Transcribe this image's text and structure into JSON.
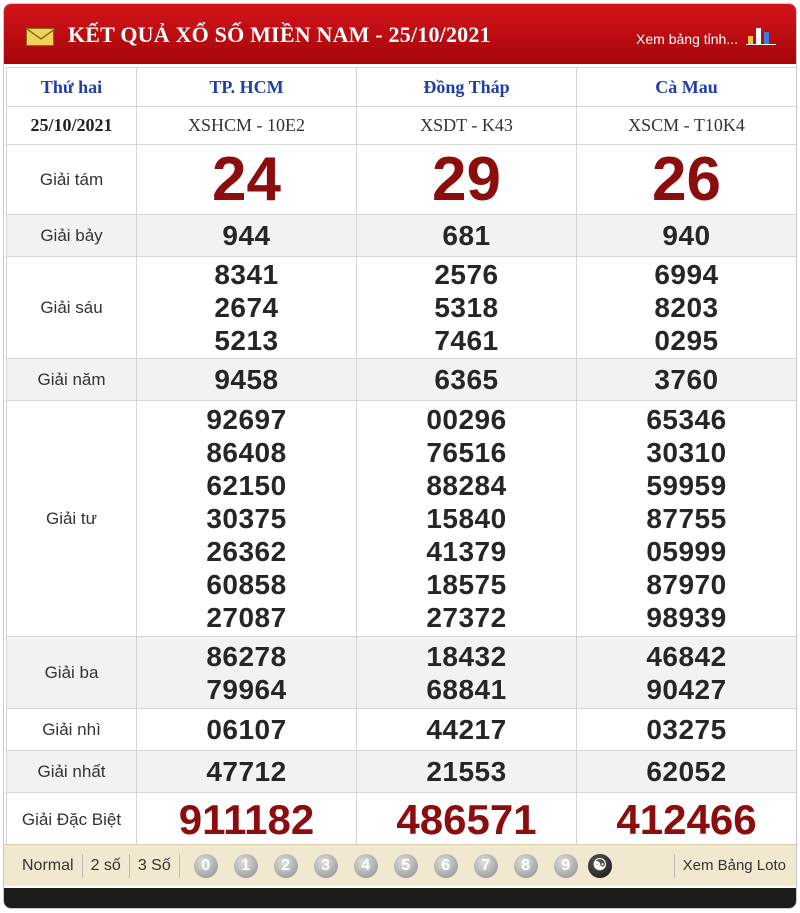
{
  "header": {
    "title": "KẾT QUẢ XỔ SỐ MIỀN NAM - 25/10/2021",
    "view_link": "Xem bảng tỉnh..."
  },
  "columns": {
    "day": "Thứ hai",
    "date": "25/10/2021",
    "provinces": [
      {
        "name": "TP. HCM",
        "code": "XSHCM - 10E2"
      },
      {
        "name": "Đồng Tháp",
        "code": "XSDT - K43"
      },
      {
        "name": "Cà Mau",
        "code": "XSCM - T10K4"
      }
    ]
  },
  "prizes": [
    {
      "name": "Giải tám",
      "style": "big",
      "values": [
        [
          "24"
        ],
        [
          "29"
        ],
        [
          "26"
        ]
      ]
    },
    {
      "name": "Giải bảy",
      "style": "num",
      "values": [
        [
          "944"
        ],
        [
          "681"
        ],
        [
          "940"
        ]
      ]
    },
    {
      "name": "Giải sáu",
      "style": "num",
      "values": [
        [
          "8341",
          "2674",
          "5213"
        ],
        [
          "2576",
          "5318",
          "7461"
        ],
        [
          "6994",
          "8203",
          "0295"
        ]
      ]
    },
    {
      "name": "Giải năm",
      "style": "num",
      "values": [
        [
          "9458"
        ],
        [
          "6365"
        ],
        [
          "3760"
        ]
      ]
    },
    {
      "name": "Giải tư",
      "style": "num",
      "values": [
        [
          "92697",
          "86408",
          "62150",
          "30375",
          "26362",
          "60858",
          "27087"
        ],
        [
          "00296",
          "76516",
          "88284",
          "15840",
          "41379",
          "18575",
          "27372"
        ],
        [
          "65346",
          "30310",
          "59959",
          "87755",
          "05999",
          "87970",
          "98939"
        ]
      ]
    },
    {
      "name": "Giải ba",
      "style": "num",
      "values": [
        [
          "86278",
          "79964"
        ],
        [
          "18432",
          "68841"
        ],
        [
          "46842",
          "90427"
        ]
      ]
    },
    {
      "name": "Giải nhì",
      "style": "num",
      "values": [
        [
          "06107"
        ],
        [
          "44217"
        ],
        [
          "03275"
        ]
      ]
    },
    {
      "name": "Giải nhất",
      "style": "num",
      "values": [
        [
          "47712"
        ],
        [
          "21553"
        ],
        [
          "62052"
        ]
      ]
    },
    {
      "name": "Giải Đặc Biệt",
      "style": "special",
      "values": [
        [
          "911182"
        ],
        [
          "486571"
        ],
        [
          "412466"
        ]
      ]
    }
  ],
  "footer": {
    "modes": [
      "Normal",
      "2 số",
      "3 Số"
    ],
    "digits": [
      "0",
      "1",
      "2",
      "3",
      "4",
      "5",
      "6",
      "7",
      "8",
      "9"
    ],
    "loto_link": "Xem Bảng Loto"
  },
  "colors": {
    "header_red": "#c10f15",
    "prize_red": "#8c0d0d",
    "header_blue": "#1f3fa8",
    "footer_bg": "#f1e9cf"
  }
}
